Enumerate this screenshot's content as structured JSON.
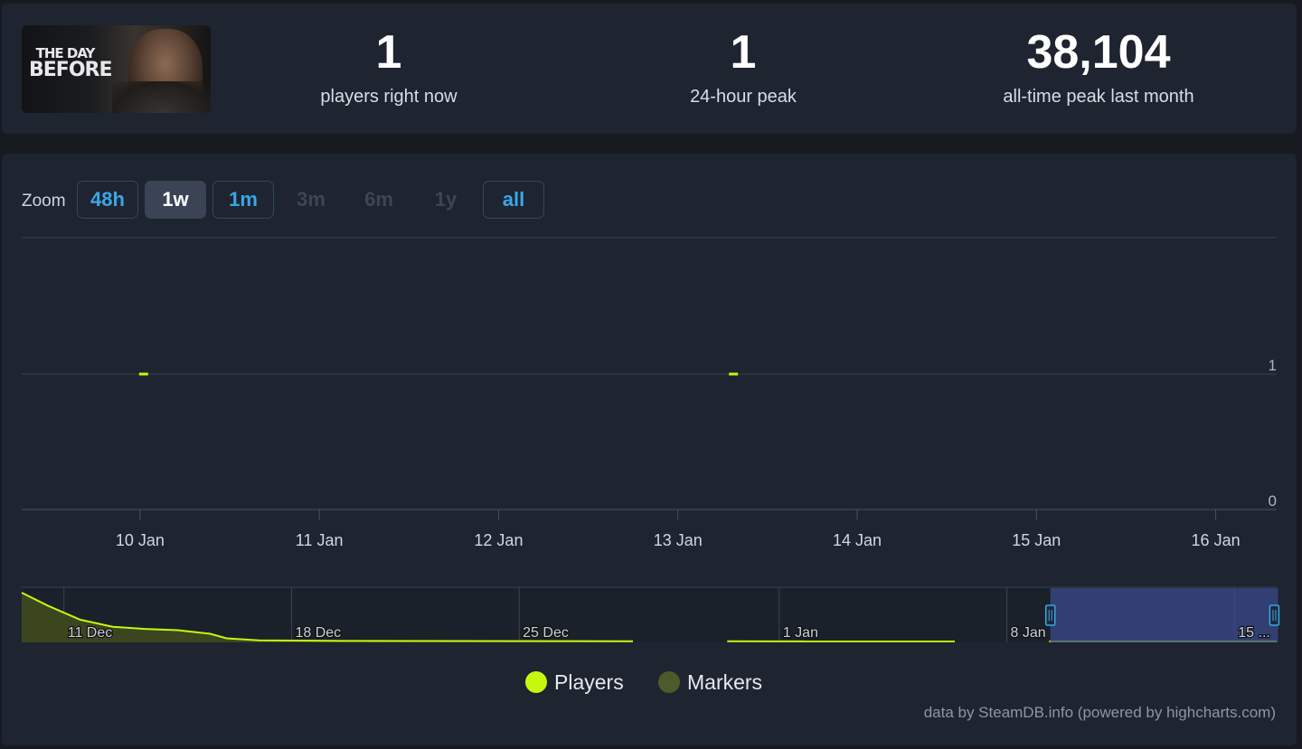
{
  "game": {
    "logo_line1": "THE DAY",
    "logo_line2": "BEFORE"
  },
  "stats": [
    {
      "value": "1",
      "label": "players right now"
    },
    {
      "value": "1",
      "label": "24-hour peak"
    },
    {
      "value": "38,104",
      "label": "all-time peak last month"
    }
  ],
  "zoom": {
    "label": "Zoom",
    "buttons": [
      {
        "label": "48h",
        "state": "enabled"
      },
      {
        "label": "1w",
        "state": "active"
      },
      {
        "label": "1m",
        "state": "enabled"
      },
      {
        "label": "3m",
        "state": "disabled"
      },
      {
        "label": "6m",
        "state": "disabled"
      },
      {
        "label": "1y",
        "state": "disabled"
      },
      {
        "label": "all",
        "state": "enabled"
      }
    ]
  },
  "legend": [
    {
      "label": "Players",
      "color": "#c6f70f"
    },
    {
      "label": "Markers",
      "color": "#4d5a2c"
    }
  ],
  "credits": "data by SteamDB.info (powered by highcharts.com)",
  "chart_data": {
    "type": "line",
    "title": "",
    "xlabel": "",
    "ylabel": "",
    "x_ticks": [
      "10 Jan",
      "11 Jan",
      "12 Jan",
      "13 Jan",
      "14 Jan",
      "15 Jan",
      "16 Jan"
    ],
    "y_ticks": [
      0,
      1
    ],
    "ylim": [
      0,
      2
    ],
    "xlim_days": [
      9.34,
      16.34
    ],
    "grid": true,
    "series": [
      {
        "name": "Players",
        "color": "#c6f70f",
        "points": [
          {
            "day": 10.02,
            "value": 1
          },
          {
            "day": 13.31,
            "value": 1
          }
        ]
      }
    ],
    "navigator": {
      "tick_labels": [
        "11 Dec",
        "18 Dec",
        "25 Dec",
        "1 Jan",
        "8 Jan",
        "15 ..."
      ],
      "tick_days": [
        -21,
        -14,
        -7,
        1,
        8,
        15
      ],
      "range_days": [
        -22.3,
        16.3
      ],
      "selected_range_days": [
        9.34,
        16.34
      ],
      "max_value": 38104,
      "series": [
        [
          -22.3,
          38104
        ],
        [
          -21.5,
          28000
        ],
        [
          -20.5,
          17000
        ],
        [
          -19.5,
          11500
        ],
        [
          -18.5,
          9800
        ],
        [
          -17.5,
          8800
        ],
        [
          -16.5,
          6000
        ],
        [
          -16.0,
          2500
        ],
        [
          -15.0,
          900
        ],
        [
          -12.0,
          400
        ],
        [
          -6.0,
          250
        ],
        [
          -3.5,
          200
        ],
        [
          -3.49,
          null
        ],
        [
          -0.6,
          null
        ],
        [
          -0.6,
          150
        ],
        [
          6.4,
          100
        ],
        [
          6.41,
          null
        ],
        [
          9.3,
          null
        ],
        [
          9.3,
          60
        ],
        [
          12.0,
          50
        ],
        [
          16.3,
          40
        ]
      ]
    }
  }
}
